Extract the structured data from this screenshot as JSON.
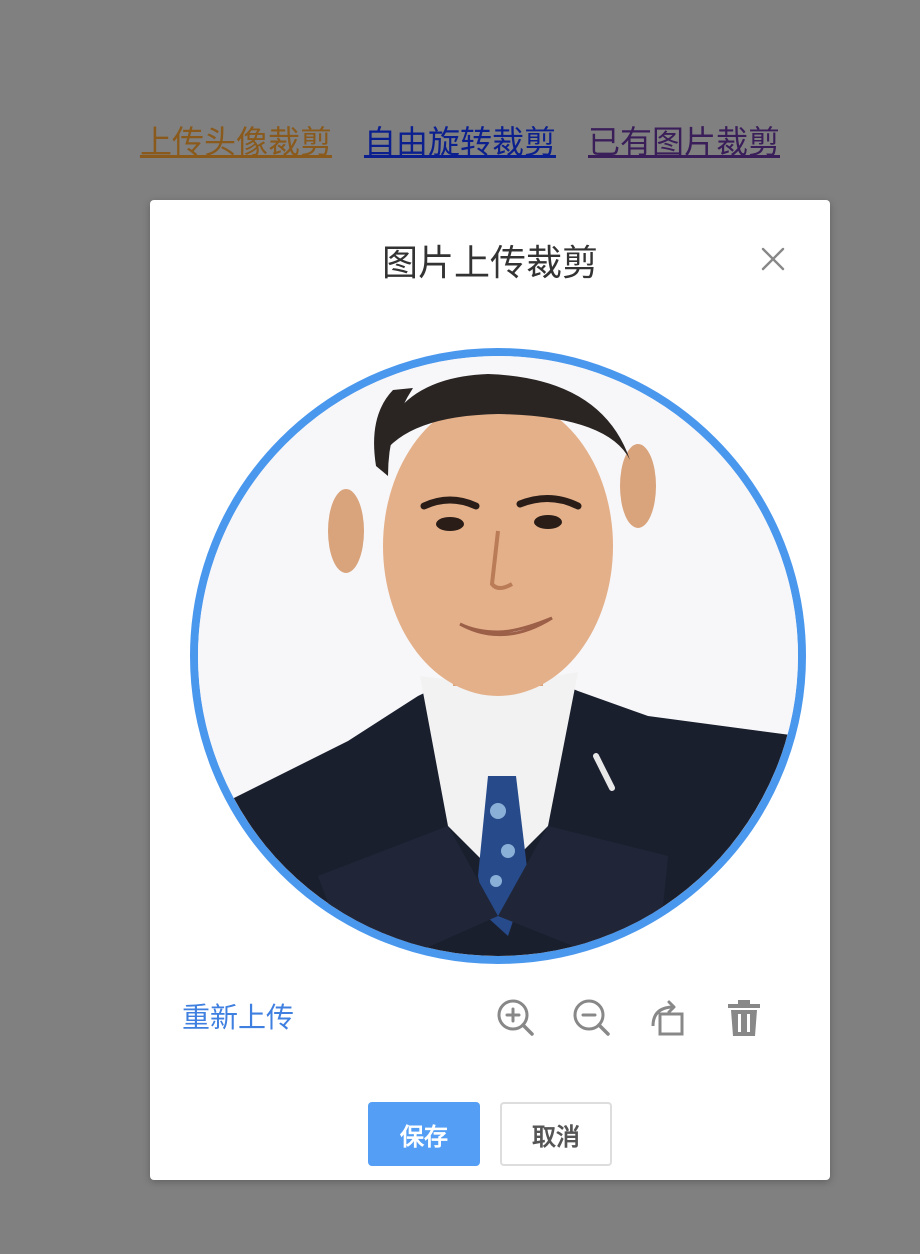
{
  "colors": {
    "backdrop": "#808080",
    "nav_upload": "#8a5a1c",
    "nav_rotate": "#0b1f8f",
    "nav_existing": "#3a1e5a",
    "crop_border": "#4a97ee",
    "link_blue": "#3e7fe0",
    "primary_button": "#549ff5"
  },
  "nav": {
    "items": [
      {
        "label": "上传头像裁剪"
      },
      {
        "label": "自由旋转裁剪"
      },
      {
        "label": "已有图片裁剪"
      }
    ]
  },
  "dialog": {
    "title": "图片上传裁剪",
    "close_icon": "close-icon",
    "image_alt": "portrait-photo",
    "reupload_label": "重新上传",
    "tools": [
      {
        "icon": "zoom-in-icon"
      },
      {
        "icon": "zoom-out-icon"
      },
      {
        "icon": "rotate-icon"
      },
      {
        "icon": "delete-icon"
      }
    ],
    "save_label": "保存",
    "cancel_label": "取消"
  }
}
